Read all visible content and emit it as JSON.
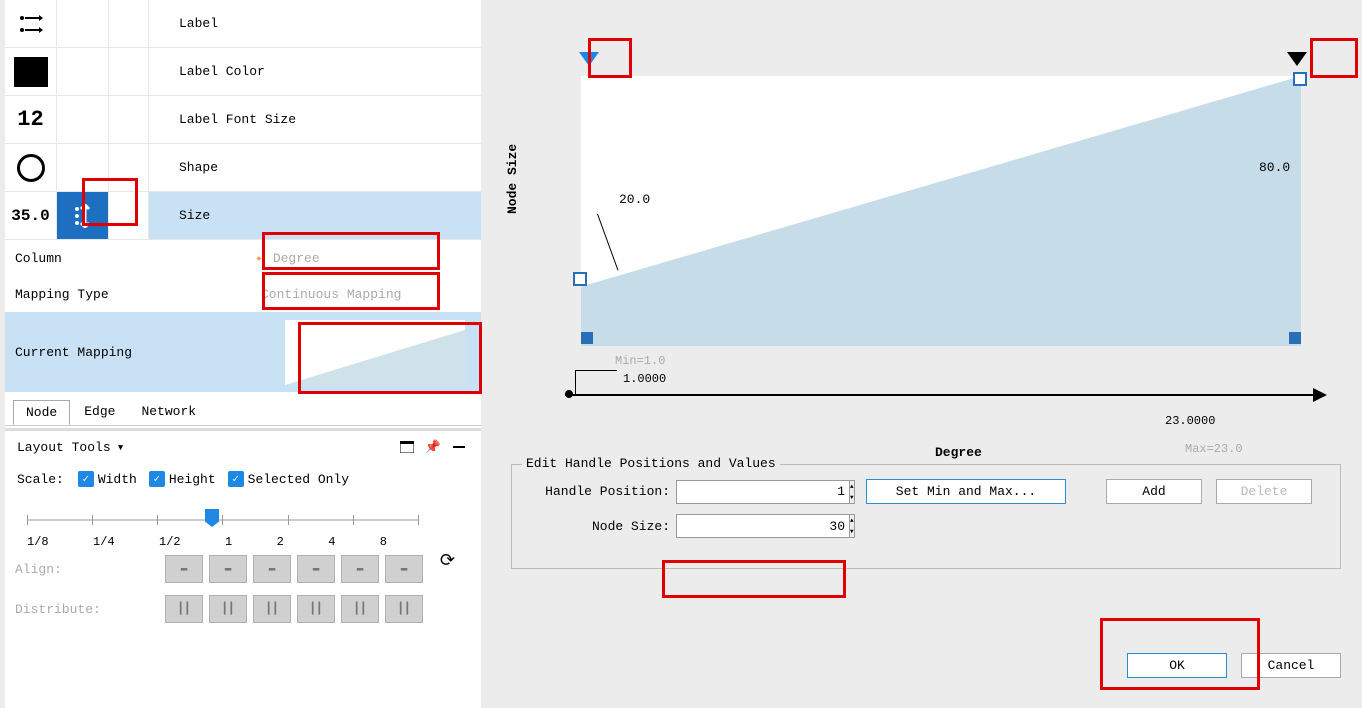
{
  "props": {
    "label": "Label",
    "labelColor": "Label Color",
    "labelFontSize": "Label Font Size",
    "labelFontSizeVal": "12",
    "shape": "Shape",
    "size": "Size",
    "sizeVal": "35.0"
  },
  "mapping": {
    "columnLabel": "Column",
    "columnVal": "Degree",
    "typeLabel": "Mapping Type",
    "typeVal": "Continuous Mapping",
    "currentLabel": "Current Mapping"
  },
  "tabs": {
    "node": "Node",
    "edge": "Edge",
    "network": "Network"
  },
  "layout": {
    "title": "Layout Tools",
    "down": "▾",
    "scale": "Scale:",
    "width": "Width",
    "height": "Height",
    "selected": "Selected Only",
    "ticks": [
      "1/8",
      "1/4",
      "1/2",
      "1",
      "2",
      "4",
      "8"
    ],
    "align": "Align:",
    "distribute": "Distribute:"
  },
  "chart": {
    "ylabel": "Node Size",
    "xlabel": "Degree",
    "v0": "20.0",
    "v1": "80.0",
    "minLbl": "Min=1.0",
    "minVal": "1.0000",
    "maxLbl": "Max=23.0",
    "maxVal": "23.0000"
  },
  "fs": {
    "legend": "Edit Handle Positions and Values",
    "hpLabel": "Handle Position:",
    "hpVal": "1",
    "nsLabel": "Node Size:",
    "nsVal": "30",
    "setminmax": "Set Min and Max...",
    "add": "Add",
    "delete": "Delete"
  },
  "dlg": {
    "ok": "OK",
    "cancel": "Cancel"
  },
  "chart_data": {
    "type": "line",
    "title": "Continuous Mapping: Degree → Node Size",
    "xlabel": "Degree",
    "ylabel": "Node Size",
    "x": [
      1.0,
      23.0
    ],
    "y": [
      20.0,
      80.0
    ],
    "xlim": [
      1.0,
      23.0
    ],
    "annotations": [
      "Min=1.0",
      "Max=23.0"
    ]
  }
}
